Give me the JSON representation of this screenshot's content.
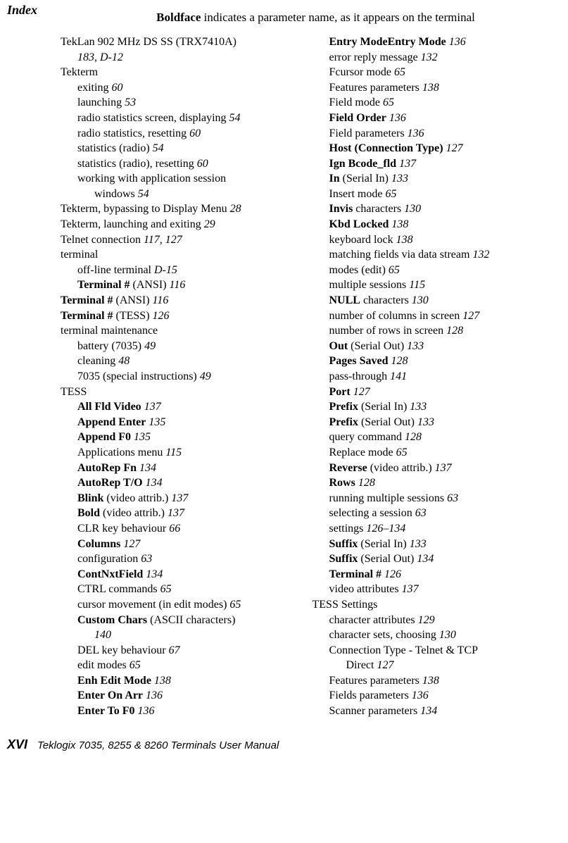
{
  "header": {
    "corner": "Index",
    "note_bold": "Boldface",
    "note_rest": " indicates a parameter name, as it appears on the terminal"
  },
  "left": [
    {
      "indent": 0,
      "parts": [
        {
          "t": "TekLan 902 MHz DS SS (TRX7410A)"
        }
      ]
    },
    {
      "indent": 0,
      "cont": "cont1",
      "parts": [
        {
          "t": "183, D-12",
          "i": true
        }
      ]
    },
    {
      "indent": 0,
      "parts": [
        {
          "t": "Tekterm"
        }
      ]
    },
    {
      "indent": 1,
      "parts": [
        {
          "t": "exiting   "
        },
        {
          "t": "60",
          "i": true
        }
      ]
    },
    {
      "indent": 1,
      "parts": [
        {
          "t": "launching   "
        },
        {
          "t": "53",
          "i": true
        }
      ]
    },
    {
      "indent": 1,
      "parts": [
        {
          "t": "radio statistics screen, displaying   "
        },
        {
          "t": "54",
          "i": true
        }
      ]
    },
    {
      "indent": 1,
      "parts": [
        {
          "t": "radio statistics, resetting   "
        },
        {
          "t": "60",
          "i": true
        }
      ]
    },
    {
      "indent": 1,
      "parts": [
        {
          "t": "statistics (radio)   "
        },
        {
          "t": "54",
          "i": true
        }
      ]
    },
    {
      "indent": 1,
      "parts": [
        {
          "t": "statistics (radio), resetting   "
        },
        {
          "t": "60",
          "i": true
        }
      ]
    },
    {
      "indent": 1,
      "parts": [
        {
          "t": "working with application session"
        }
      ]
    },
    {
      "indent": 1,
      "cont": "cont",
      "parts": [
        {
          "t": "windows   "
        },
        {
          "t": "54",
          "i": true
        }
      ]
    },
    {
      "indent": 0,
      "parts": [
        {
          "t": "Tekterm, bypassing to Display Menu   "
        },
        {
          "t": "28",
          "i": true
        }
      ]
    },
    {
      "indent": 0,
      "parts": [
        {
          "t": "Tekterm, launching and exiting   "
        },
        {
          "t": "29",
          "i": true
        }
      ]
    },
    {
      "indent": 0,
      "parts": [
        {
          "t": "Telnet connection   "
        },
        {
          "t": "117, 127",
          "i": true
        }
      ]
    },
    {
      "indent": 0,
      "parts": [
        {
          "t": "terminal"
        }
      ]
    },
    {
      "indent": 1,
      "parts": [
        {
          "t": "off-line terminal   "
        },
        {
          "t": "D-15",
          "i": true
        }
      ]
    },
    {
      "indent": 1,
      "parts": [
        {
          "t": "Terminal #",
          "b": true
        },
        {
          "t": " (ANSI)   "
        },
        {
          "t": "116",
          "i": true
        }
      ]
    },
    {
      "indent": 0,
      "parts": [
        {
          "t": "Terminal #",
          "b": true
        },
        {
          "t": " (ANSI)   "
        },
        {
          "t": "116",
          "i": true
        }
      ]
    },
    {
      "indent": 0,
      "parts": [
        {
          "t": "Terminal #",
          "b": true
        },
        {
          "t": " (TESS)   "
        },
        {
          "t": "126",
          "i": true
        }
      ]
    },
    {
      "indent": 0,
      "parts": [
        {
          "t": "terminal maintenance"
        }
      ]
    },
    {
      "indent": 1,
      "parts": [
        {
          "t": "battery (7035)   "
        },
        {
          "t": "49",
          "i": true
        }
      ]
    },
    {
      "indent": 1,
      "parts": [
        {
          "t": "cleaning   "
        },
        {
          "t": "48",
          "i": true
        }
      ]
    },
    {
      "indent": 1,
      "parts": [
        {
          "t": "7035 (special instructions)   "
        },
        {
          "t": "49",
          "i": true
        }
      ]
    },
    {
      "indent": 0,
      "parts": [
        {
          "t": "TESS"
        }
      ]
    },
    {
      "indent": 1,
      "parts": [
        {
          "t": "All Fld Video",
          "b": true
        },
        {
          "t": "   "
        },
        {
          "t": "137",
          "i": true
        }
      ]
    },
    {
      "indent": 1,
      "parts": [
        {
          "t": "Append Enter",
          "b": true
        },
        {
          "t": "   "
        },
        {
          "t": "135",
          "i": true
        }
      ]
    },
    {
      "indent": 1,
      "parts": [
        {
          "t": "Append F0",
          "b": true
        },
        {
          "t": "   "
        },
        {
          "t": "135",
          "i": true
        }
      ]
    },
    {
      "indent": 1,
      "parts": [
        {
          "t": "Applications menu   "
        },
        {
          "t": "115",
          "i": true
        }
      ]
    },
    {
      "indent": 1,
      "parts": [
        {
          "t": "AutoRep Fn",
          "b": true
        },
        {
          "t": "   "
        },
        {
          "t": "134",
          "i": true
        }
      ]
    },
    {
      "indent": 1,
      "parts": [
        {
          "t": "AutoRep T/O",
          "b": true
        },
        {
          "t": "   "
        },
        {
          "t": "134",
          "i": true
        }
      ]
    },
    {
      "indent": 1,
      "parts": [
        {
          "t": "Blink",
          "b": true
        },
        {
          "t": " (video attrib.)   "
        },
        {
          "t": "137",
          "i": true
        }
      ]
    },
    {
      "indent": 1,
      "parts": [
        {
          "t": "Bold",
          "b": true
        },
        {
          "t": " (video attrib.)   "
        },
        {
          "t": "137",
          "i": true
        }
      ]
    },
    {
      "indent": 1,
      "parts": [
        {
          "t": "CLR key behaviour   "
        },
        {
          "t": "66",
          "i": true
        }
      ]
    },
    {
      "indent": 1,
      "parts": [
        {
          "t": "Columns",
          "b": true
        },
        {
          "t": "   "
        },
        {
          "t": "127",
          "i": true
        }
      ]
    },
    {
      "indent": 1,
      "parts": [
        {
          "t": "configuration   "
        },
        {
          "t": "63",
          "i": true
        }
      ]
    },
    {
      "indent": 1,
      "parts": [
        {
          "t": "ContNxtField",
          "b": true
        },
        {
          "t": "   "
        },
        {
          "t": "134",
          "i": true
        }
      ]
    },
    {
      "indent": 1,
      "parts": [
        {
          "t": "CTRL commands   "
        },
        {
          "t": "65",
          "i": true
        }
      ]
    },
    {
      "indent": 1,
      "parts": [
        {
          "t": "cursor movement (in edit modes)   "
        },
        {
          "t": "65",
          "i": true
        }
      ]
    },
    {
      "indent": 1,
      "parts": [
        {
          "t": "Custom Chars",
          "b": true
        },
        {
          "t": " (ASCII characters)"
        }
      ]
    },
    {
      "indent": 1,
      "cont": "cont",
      "parts": [
        {
          "t": "140",
          "i": true
        }
      ]
    },
    {
      "indent": 1,
      "parts": [
        {
          "t": "DEL key behaviour   "
        },
        {
          "t": "67",
          "i": true
        }
      ]
    },
    {
      "indent": 1,
      "parts": [
        {
          "t": "edit modes   "
        },
        {
          "t": "65",
          "i": true
        }
      ]
    },
    {
      "indent": 1,
      "parts": [
        {
          "t": "Enh Edit Mode",
          "b": true
        },
        {
          "t": "   "
        },
        {
          "t": "138",
          "i": true
        }
      ]
    },
    {
      "indent": 1,
      "parts": [
        {
          "t": "Enter On Arr",
          "b": true
        },
        {
          "t": "   "
        },
        {
          "t": "136",
          "i": true
        }
      ]
    },
    {
      "indent": 1,
      "parts": [
        {
          "t": "Enter To F0",
          "b": true
        },
        {
          "t": "   "
        },
        {
          "t": "136",
          "i": true
        }
      ]
    }
  ],
  "right": [
    {
      "indent": 1,
      "parts": [
        {
          "t": "Entry ModeEntry Mode",
          "b": true
        },
        {
          "t": "   "
        },
        {
          "t": "136",
          "i": true
        }
      ]
    },
    {
      "indent": 1,
      "parts": [
        {
          "t": "error reply message   "
        },
        {
          "t": "132",
          "i": true
        }
      ]
    },
    {
      "indent": 1,
      "parts": [
        {
          "t": "Fcursor mode   "
        },
        {
          "t": "65",
          "i": true
        }
      ]
    },
    {
      "indent": 1,
      "parts": [
        {
          "t": "Features parameters   "
        },
        {
          "t": "138",
          "i": true
        }
      ]
    },
    {
      "indent": 1,
      "parts": [
        {
          "t": "Field mode   "
        },
        {
          "t": "65",
          "i": true
        }
      ]
    },
    {
      "indent": 1,
      "parts": [
        {
          "t": "Field Order",
          "b": true
        },
        {
          "t": "   "
        },
        {
          "t": "136",
          "i": true
        }
      ]
    },
    {
      "indent": 1,
      "parts": [
        {
          "t": "Field parameters   "
        },
        {
          "t": "136",
          "i": true
        }
      ]
    },
    {
      "indent": 1,
      "parts": [
        {
          "t": "Host (Connection Type)",
          "b": true
        },
        {
          "t": "   "
        },
        {
          "t": "127",
          "i": true
        }
      ]
    },
    {
      "indent": 1,
      "parts": [
        {
          "t": "Ign Bcode_fld",
          "b": true
        },
        {
          "t": "   "
        },
        {
          "t": "137",
          "i": true
        }
      ]
    },
    {
      "indent": 1,
      "parts": [
        {
          "t": "In",
          "b": true
        },
        {
          "t": " (Serial In)   "
        },
        {
          "t": "133",
          "i": true
        }
      ]
    },
    {
      "indent": 1,
      "parts": [
        {
          "t": "Insert mode   "
        },
        {
          "t": "65",
          "i": true
        }
      ]
    },
    {
      "indent": 1,
      "parts": [
        {
          "t": "Invis",
          "b": true
        },
        {
          "t": " characters   "
        },
        {
          "t": "130",
          "i": true
        }
      ]
    },
    {
      "indent": 1,
      "parts": [
        {
          "t": "Kbd Locked",
          "b": true
        },
        {
          "t": "   "
        },
        {
          "t": "138",
          "i": true
        }
      ]
    },
    {
      "indent": 1,
      "parts": [
        {
          "t": "keyboard lock   "
        },
        {
          "t": "138",
          "i": true
        }
      ]
    },
    {
      "indent": 1,
      "parts": [
        {
          "t": "matching fields via data stream   "
        },
        {
          "t": "132",
          "i": true
        }
      ]
    },
    {
      "indent": 1,
      "parts": [
        {
          "t": "modes (edit)   "
        },
        {
          "t": "65",
          "i": true
        }
      ]
    },
    {
      "indent": 1,
      "parts": [
        {
          "t": "multiple sessions   "
        },
        {
          "t": "115",
          "i": true
        }
      ]
    },
    {
      "indent": 1,
      "parts": [
        {
          "t": "NULL",
          "b": true
        },
        {
          "t": " characters   "
        },
        {
          "t": "130",
          "i": true
        }
      ]
    },
    {
      "indent": 1,
      "parts": [
        {
          "t": "number of columns in screen   "
        },
        {
          "t": "127",
          "i": true
        }
      ]
    },
    {
      "indent": 1,
      "parts": [
        {
          "t": "number of rows in screen   "
        },
        {
          "t": "128",
          "i": true
        }
      ]
    },
    {
      "indent": 1,
      "parts": [
        {
          "t": "Out",
          "b": true
        },
        {
          "t": " (Serial Out)   "
        },
        {
          "t": "133",
          "i": true
        }
      ]
    },
    {
      "indent": 1,
      "parts": [
        {
          "t": "Pages Saved",
          "b": true
        },
        {
          "t": "   "
        },
        {
          "t": "128",
          "i": true
        }
      ]
    },
    {
      "indent": 1,
      "parts": [
        {
          "t": "pass-through   "
        },
        {
          "t": "141",
          "i": true
        }
      ]
    },
    {
      "indent": 1,
      "parts": [
        {
          "t": "Port",
          "b": true
        },
        {
          "t": "   "
        },
        {
          "t": "127",
          "i": true
        }
      ]
    },
    {
      "indent": 1,
      "parts": [
        {
          "t": "Prefix",
          "b": true
        },
        {
          "t": " (Serial In)   "
        },
        {
          "t": "133",
          "i": true
        }
      ]
    },
    {
      "indent": 1,
      "parts": [
        {
          "t": "Prefix",
          "b": true
        },
        {
          "t": " (Serial Out)   "
        },
        {
          "t": "133",
          "i": true
        }
      ]
    },
    {
      "indent": 1,
      "parts": [
        {
          "t": "query command   "
        },
        {
          "t": "128",
          "i": true
        }
      ]
    },
    {
      "indent": 1,
      "parts": [
        {
          "t": "Replace mode   "
        },
        {
          "t": "65",
          "i": true
        }
      ]
    },
    {
      "indent": 1,
      "parts": [
        {
          "t": "Reverse",
          "b": true
        },
        {
          "t": " (video attrib.)   "
        },
        {
          "t": "137",
          "i": true
        }
      ]
    },
    {
      "indent": 1,
      "parts": [
        {
          "t": "Rows",
          "b": true
        },
        {
          "t": "   "
        },
        {
          "t": "128",
          "i": true
        }
      ]
    },
    {
      "indent": 1,
      "parts": [
        {
          "t": "running multiple sessions   "
        },
        {
          "t": "63",
          "i": true
        }
      ]
    },
    {
      "indent": 1,
      "parts": [
        {
          "t": "selecting a session   "
        },
        {
          "t": "63",
          "i": true
        }
      ]
    },
    {
      "indent": 1,
      "parts": [
        {
          "t": "settings   "
        },
        {
          "t": "126–134",
          "i": true
        }
      ]
    },
    {
      "indent": 1,
      "parts": [
        {
          "t": "Suffix",
          "b": true
        },
        {
          "t": " (Serial In)   "
        },
        {
          "t": "133",
          "i": true
        }
      ]
    },
    {
      "indent": 1,
      "parts": [
        {
          "t": "Suffix",
          "b": true
        },
        {
          "t": " (Serial Out)   "
        },
        {
          "t": "134",
          "i": true
        }
      ]
    },
    {
      "indent": 1,
      "parts": [
        {
          "t": "Terminal #",
          "b": true
        },
        {
          "t": "   "
        },
        {
          "t": "126",
          "i": true
        }
      ]
    },
    {
      "indent": 1,
      "parts": [
        {
          "t": "video attributes   "
        },
        {
          "t": "137",
          "i": true
        }
      ]
    },
    {
      "indent": 0,
      "parts": [
        {
          "t": "TESS Settings"
        }
      ]
    },
    {
      "indent": 1,
      "parts": [
        {
          "t": "character attributes   "
        },
        {
          "t": "129",
          "i": true
        }
      ]
    },
    {
      "indent": 1,
      "parts": [
        {
          "t": "character sets, choosing   "
        },
        {
          "t": "130",
          "i": true
        }
      ]
    },
    {
      "indent": 1,
      "parts": [
        {
          "t": "Connection Type - Telnet & TCP"
        }
      ]
    },
    {
      "indent": 1,
      "cont": "cont",
      "parts": [
        {
          "t": "Direct   "
        },
        {
          "t": "127",
          "i": true
        }
      ]
    },
    {
      "indent": 1,
      "parts": [
        {
          "t": "Features parameters   "
        },
        {
          "t": "138",
          "i": true
        }
      ]
    },
    {
      "indent": 1,
      "parts": [
        {
          "t": "Fields parameters   "
        },
        {
          "t": "136",
          "i": true
        }
      ]
    },
    {
      "indent": 1,
      "parts": [
        {
          "t": "Scanner parameters   "
        },
        {
          "t": "134",
          "i": true
        }
      ]
    }
  ],
  "footer": {
    "page": "XVI",
    "manual": "Teklogix 7035, 8255 & 8260 Terminals User Manual"
  }
}
